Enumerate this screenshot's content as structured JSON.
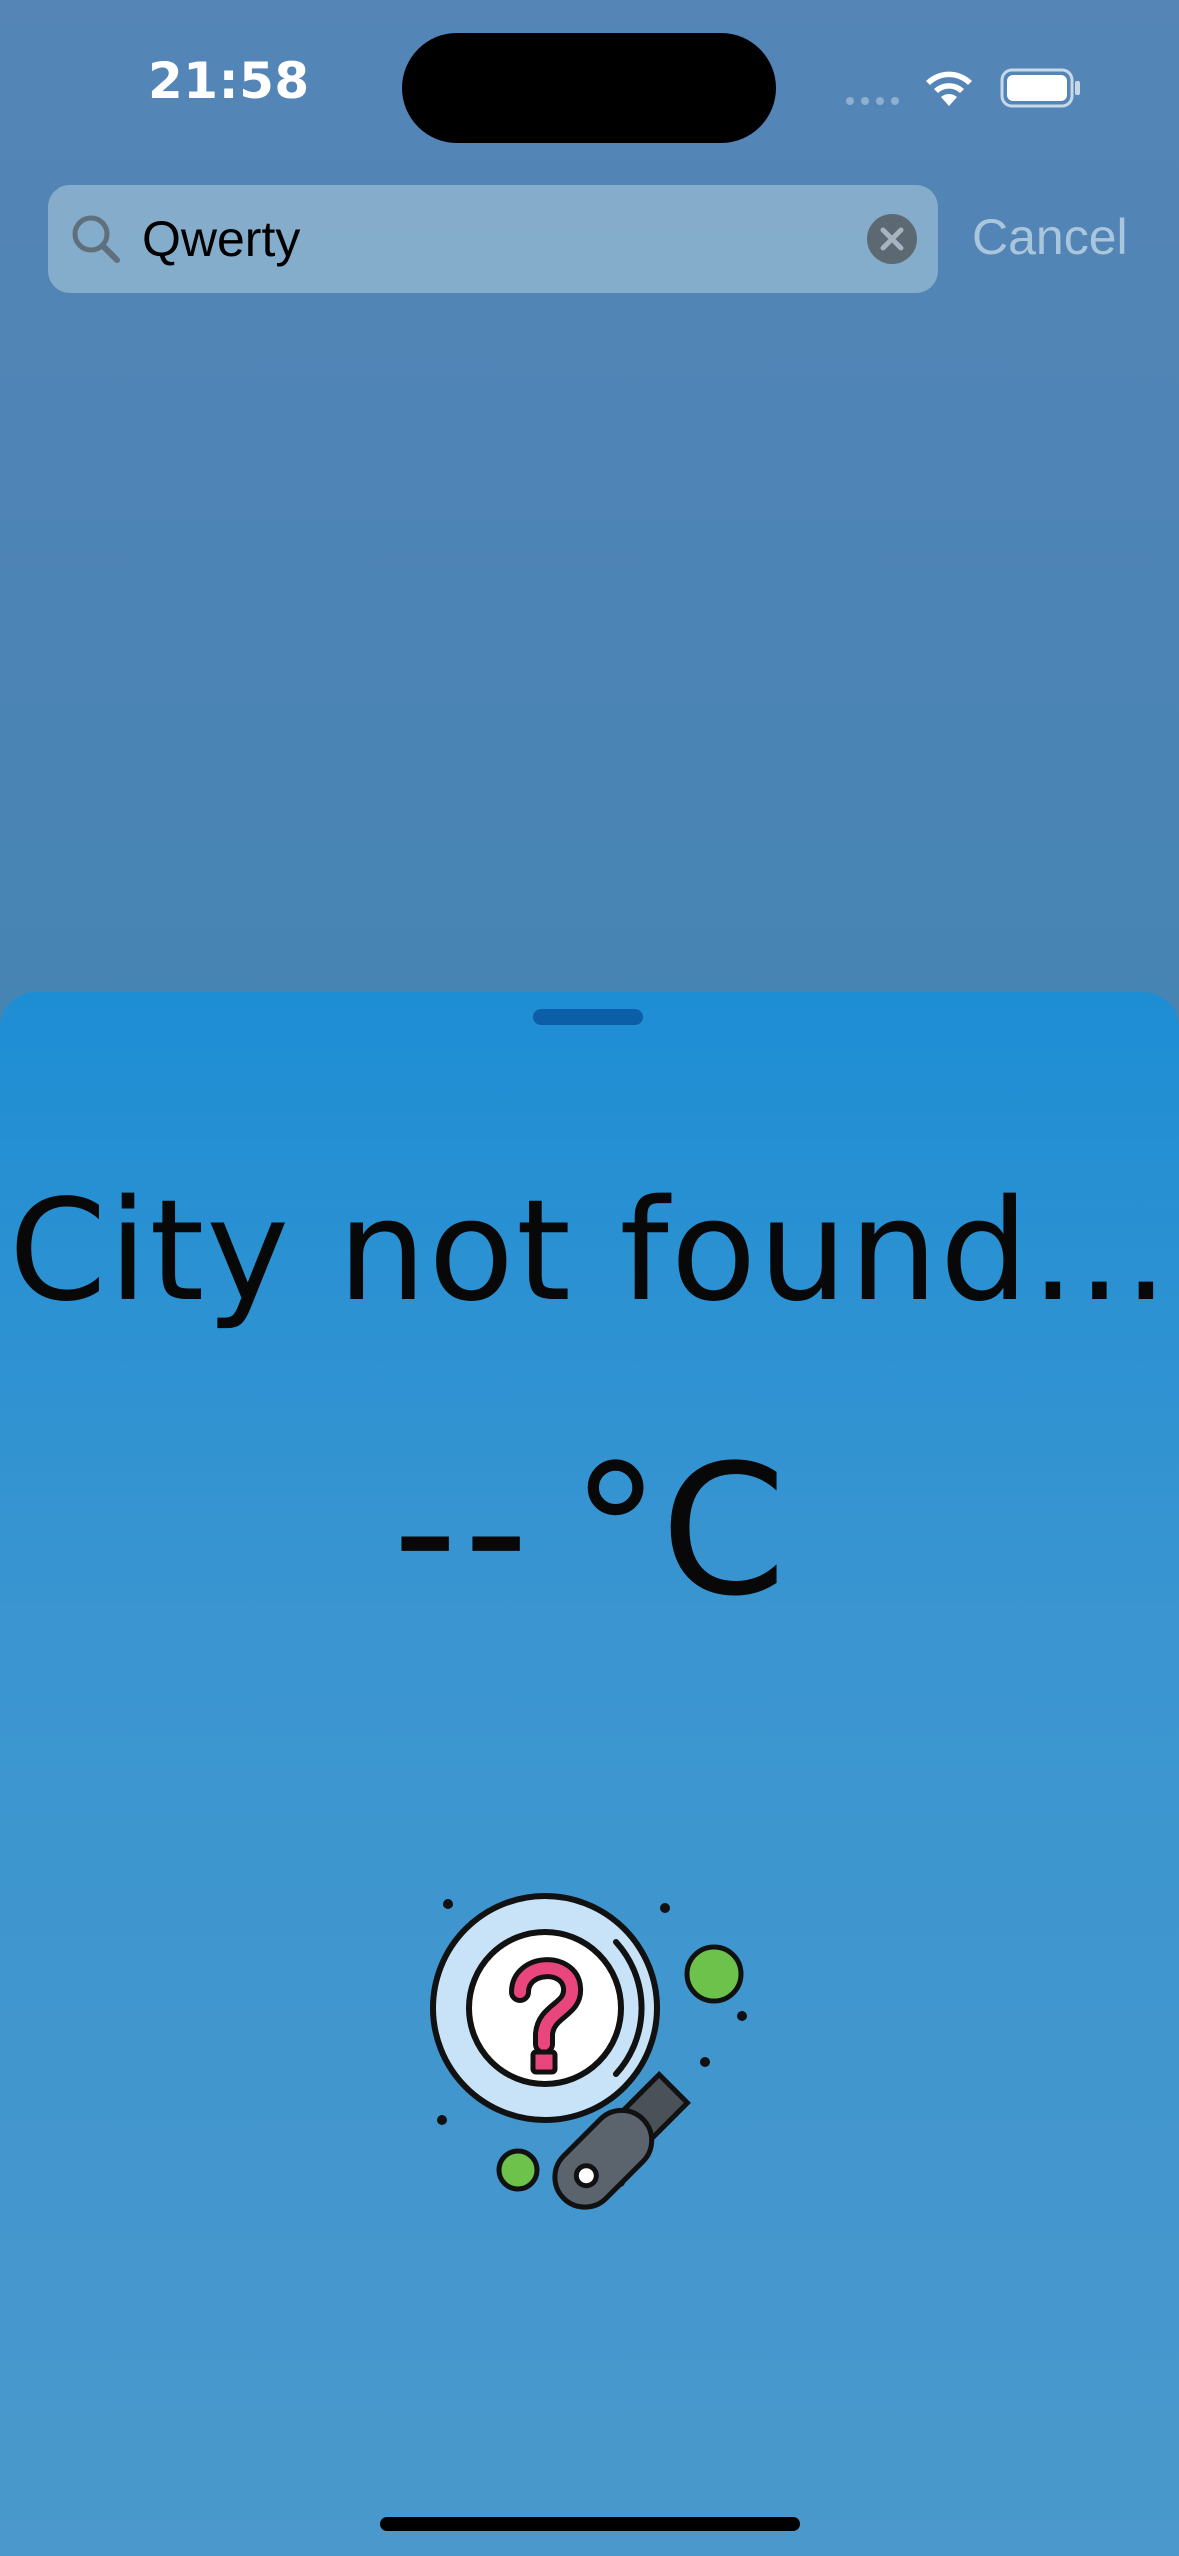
{
  "status_bar": {
    "time": "21:58",
    "wifi_icon": "wifi-icon",
    "battery_icon": "battery-icon"
  },
  "search": {
    "value": "Qwerty",
    "search_icon": "search-icon",
    "clear_icon": "clear-icon",
    "cancel_label": "Cancel"
  },
  "sheet": {
    "title": "City not found...",
    "temperature": "--",
    "unit": "°C",
    "illustration_icon": "magnifier-question-icon"
  },
  "colors": {
    "background_top": "#5585b7",
    "sheet_top": "#1e8ed4",
    "sheet_bottom": "#4a98cc",
    "grabber": "#0c5ea6",
    "cancel_text": "#a9c6dd",
    "accent_green": "#6cc24a",
    "question_pink": "#e8467c"
  }
}
